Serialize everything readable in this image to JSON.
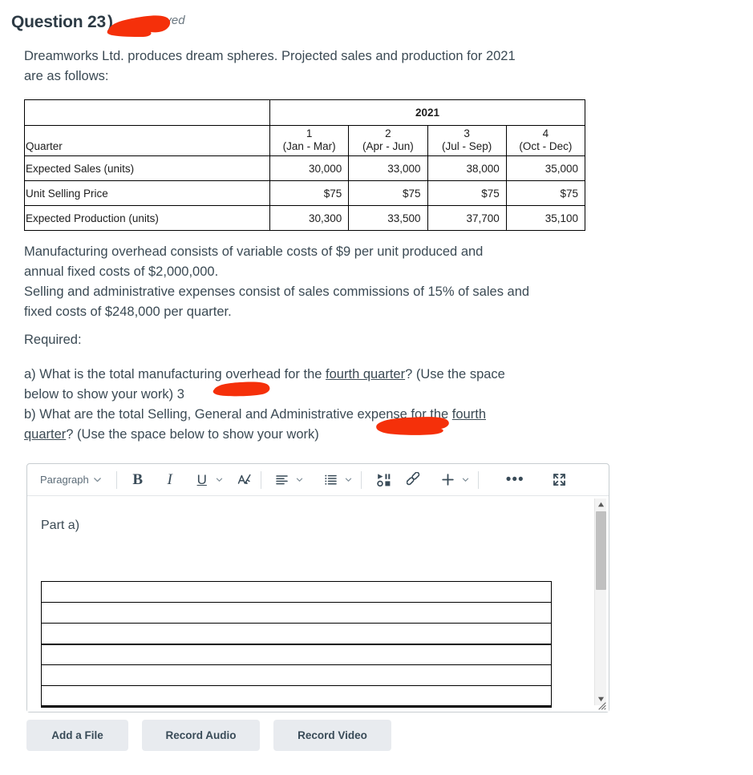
{
  "header": {
    "question_title": "Question 23",
    "question_suffix": ")",
    "saved_label": "Saved",
    "check_icon": "check-icon"
  },
  "intro": {
    "line1": "Dreamworks Ltd. produces dream spheres. Projected sales and production for 2021",
    "line2": "are as follows:"
  },
  "data_table": {
    "year_header": "2021",
    "row_label_header": "Quarter",
    "quarters": [
      {
        "number": "1",
        "months": "(Jan - Mar)"
      },
      {
        "number": "2",
        "months": "(Apr - Jun)"
      },
      {
        "number": "3",
        "months": "(Jul - Sep)"
      },
      {
        "number": "4",
        "months": "(Oct - Dec)"
      }
    ],
    "rows": [
      {
        "label": "Expected Sales (units)",
        "values": [
          "30,000",
          "33,000",
          "38,000",
          "35,000"
        ]
      },
      {
        "label": "Unit Selling Price",
        "values": [
          "$75",
          "$75",
          "$75",
          "$75"
        ]
      },
      {
        "label": "Expected Production (units)",
        "values": [
          "30,300",
          "33,500",
          "37,700",
          "35,100"
        ]
      }
    ]
  },
  "notes": {
    "mfg_line1": "Manufacturing overhead consists of variable costs of $9 per unit produced and",
    "mfg_line2": "annual fixed costs of $2,000,000.",
    "sga_line1": "Selling and administrative expenses consist of sales commissions of 15% of sales and",
    "sga_line2": "fixed costs of $248,000 per quarter."
  },
  "required": {
    "heading": "Required:",
    "a_part1": "a) What is the total manufacturing overhead for the ",
    "a_underlined": "fourth quarter",
    "a_part2": "?  (Use the space",
    "a_line2": "below to show your work)  3",
    "b_part1": "b) What are the total Selling, General and Administrative expense for the ",
    "b_underlined1": "fourth",
    "b_underlined2": "quarter",
    "b_part2": "?  (Use the space below to show your work)"
  },
  "editor": {
    "toolbar": {
      "paragraph_label": "Paragraph",
      "bold_label": "B",
      "italic_label": "I",
      "underline_label": "U",
      "text_color_icon": "text-color-icon",
      "align_icon": "align-left-icon",
      "list_icon": "bulleted-list-icon",
      "media_icon": "media-record-icon",
      "link_icon": "link-icon",
      "plus_icon": "plus-icon",
      "overflow_label": "•••",
      "fullscreen_icon": "fullscreen-icon"
    },
    "content": {
      "part_a_label": "Part a)",
      "answer_rows": 6
    },
    "scrollbar": {
      "up_icon": "scroll-up-arrow-icon",
      "down_icon": "scroll-down-arrow-icon",
      "resize_icon": "resize-grip-icon"
    }
  },
  "buttons": {
    "add_file": "Add a File",
    "record_audio": "Record Audio",
    "record_video": "Record Video"
  },
  "colors": {
    "redaction_red": "#f5300a",
    "text": "#2d3b45",
    "muted": "#6b7780",
    "button_bg": "#e8ebef"
  }
}
